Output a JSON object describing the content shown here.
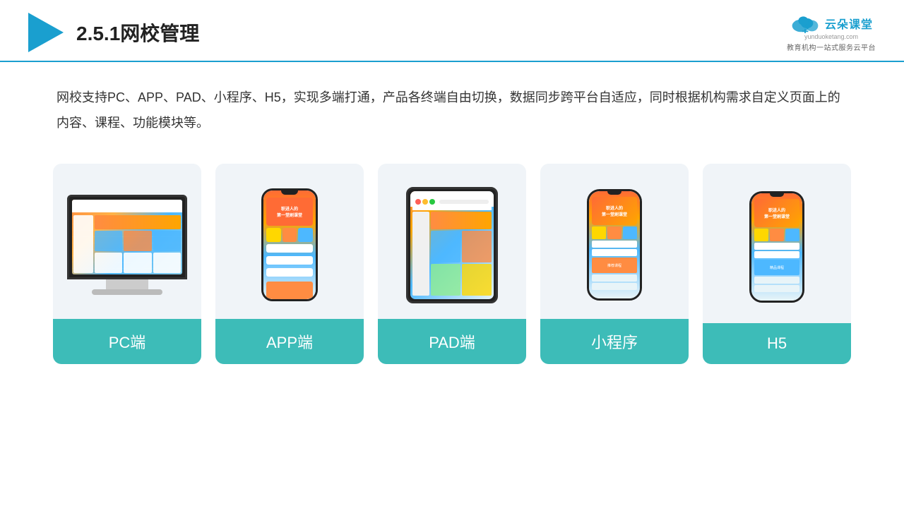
{
  "header": {
    "title": "2.5.1网校管理",
    "brand": {
      "name": "云朵课堂",
      "url": "yunduoketang.com",
      "subtitle": "教育机构一站式服务云平台"
    }
  },
  "description": {
    "text": "网校支持PC、APP、PAD、小程序、H5，实现多端打通，产品各终端自由切换，数据同步跨平台自适应，同时根据机构需求自定义页面上的内容、课程、功能模块等。"
  },
  "cards": [
    {
      "id": "pc",
      "label": "PC端"
    },
    {
      "id": "app",
      "label": "APP端"
    },
    {
      "id": "pad",
      "label": "PAD端"
    },
    {
      "id": "miniprogram",
      "label": "小程序"
    },
    {
      "id": "h5",
      "label": "H5"
    }
  ]
}
